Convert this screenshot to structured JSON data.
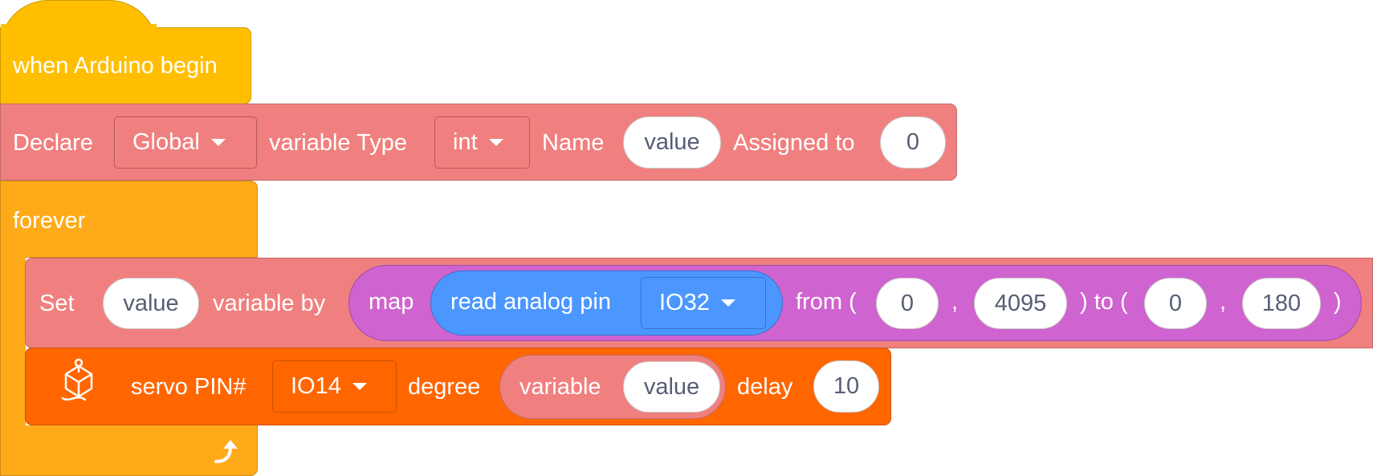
{
  "hat_block": {
    "label": "when Arduino begin"
  },
  "declare_block": {
    "label": "Declare",
    "scope": "Global",
    "type_label": "variable Type",
    "type": "int",
    "name_label": "Name",
    "name": "value",
    "assign_label": "Assigned to",
    "assign_value": "0"
  },
  "forever_block": {
    "label": "forever",
    "loop_icon": "loop-arrow-icon"
  },
  "set_block": {
    "label": "Set",
    "variable": "value",
    "by_label": "variable by",
    "map": {
      "label": "map",
      "read": {
        "label": "read analog pin",
        "pin": "IO32"
      },
      "from_label": "from (",
      "from_low": "0",
      "comma1": ",",
      "from_high": "4095",
      "to_label": ") to (",
      "to_low": "0",
      "comma2": ",",
      "to_high": "180",
      "close": ")"
    }
  },
  "servo_block": {
    "icon": "servo-icon",
    "pin_label": "servo PIN#",
    "pin": "IO14",
    "degree_label": "degree",
    "variable_label": "variable",
    "variable": "value",
    "delay_label": "delay",
    "delay": "10"
  },
  "colors": {
    "events": "#ffbf00",
    "variables": "#f0807f",
    "control": "#ffab19",
    "operators": "#cf63cf",
    "sensing": "#4c97ff",
    "servo": "#ff6600"
  }
}
